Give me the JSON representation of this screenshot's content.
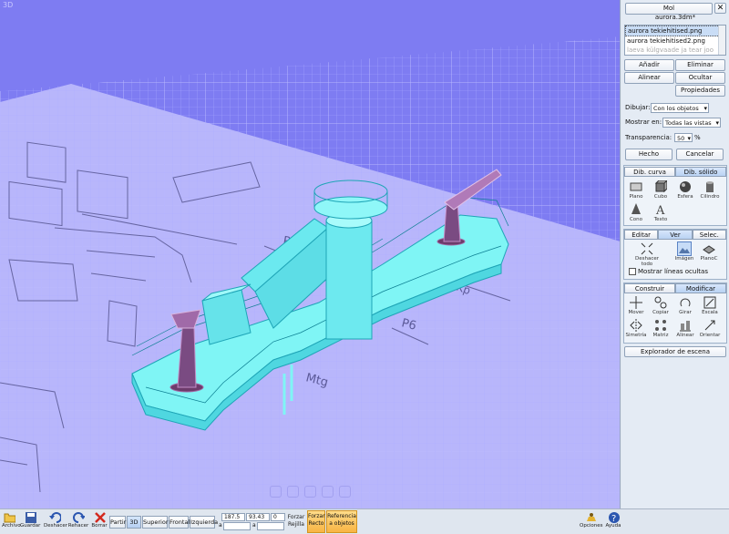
{
  "viewport": {
    "label": "3D"
  },
  "panel": {
    "title": "Mol",
    "filename": "aurora.3dm*",
    "image_list": [
      "aurora tekiehitised.png",
      "aurora tekiehitised2.png",
      "laeva külgvaade ja tear joo"
    ],
    "add": "Añadir",
    "delete": "Eliminar",
    "align": "Alinear",
    "hide": "Ocultar",
    "properties": "Propiedades",
    "draw_label": "Dibujar:",
    "draw_value": "Con los objetos",
    "show_label": "Mostrar en:",
    "show_value": "Todas las vistas",
    "transparency_label": "Transparencia:",
    "transparency_value": "50",
    "percent": "%",
    "done": "Hecho",
    "cancel": "Cancelar"
  },
  "draw_tabs": [
    "Dib. curva",
    "Dib. sólido"
  ],
  "solids": [
    "Plano",
    "Cubo",
    "Esfera",
    "Cilindro",
    "Cono",
    "Texto"
  ],
  "view_tabs": [
    "Editar",
    "Ver",
    "Selec."
  ],
  "view_tools": [
    "Deshacer todo",
    "Imágen",
    "PlanoC"
  ],
  "show_hidden_lines": "Mostrar líneas ocultas",
  "modify_tabs": [
    "Construir",
    "Modificar"
  ],
  "modify_tools": [
    "Mover",
    "Copiar",
    "Girar",
    "Escala",
    "Simetría",
    "Matriz",
    "Alinear",
    "Orientar"
  ],
  "scene_explorer": "Explorador de escena",
  "toolbar": {
    "file": "Archivo",
    "save": "Guardar",
    "undo": "Deshacer",
    "redo": "Rehacer",
    "delete": "Borrar",
    "split": "Partir",
    "views": [
      "3D",
      "Superior",
      "Frontal",
      "Izquierda"
    ],
    "coords": [
      "187.5",
      "93.43",
      "0"
    ],
    "coord_a1": "a",
    "coord_a2": "a",
    "force": "Forzar",
    "grid": "Rejilla",
    "force2": "Forzar",
    "straight": "Recto",
    "reference": "Referencia",
    "to_objects": "a objetos",
    "options": "Opciones",
    "help": "Ayuda"
  },
  "colors": {
    "viewport_bg": "#7e7cf2",
    "model_cyan": "#7ff5f5",
    "accent_orange": "#f8b443"
  }
}
